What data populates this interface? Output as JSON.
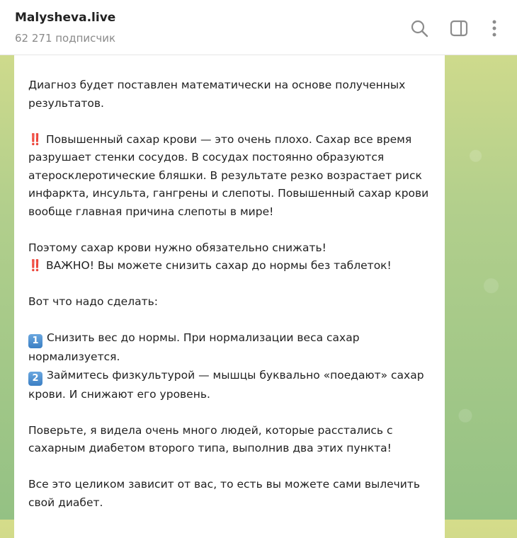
{
  "header": {
    "title": "Malysheva.live",
    "subscribers": "62 271 подписчик",
    "icons": [
      "search-icon",
      "side-panel-icon",
      "more-vertical-icon"
    ]
  },
  "message": {
    "p_diagnosis": "Диагноз будет поставлен математически на основе полученных результатов.",
    "alert_emoji": "‼️",
    "p_sugar": "Повышенный сахар крови — это очень плохо. Сахар все время разрушает стенки сосудов. В сосудах постоянно образуются атеросклеротические бляшки. В результате резко возрастает риск инфаркта, инсульта, гангрены и слепоты. Повышенный сахар крови вообще главная причина слепоты в мире!",
    "p_reduce": "Поэтому сахар крови нужно обязательно снижать!",
    "p_important": "ВАЖНО! Вы можете снизить сахар до нормы без таблеток!",
    "p_todo": "Вот что надо сделать:",
    "step1_num": "1",
    "step1": "Снизить вес до нормы. При нормализации веса сахар нормализуется.",
    "step2_num": "2",
    "step2": "Займитесь физкультурой — мышцы буквально «поедают» сахар крови. И снижают его уровень.",
    "p_believe": "Поверьте, я видела очень много людей, которые расстались с сахарным диабетом второго типа, выполнив два этих пункта!",
    "p_last": "Все это целиком зависит от вас, то есть вы можете сами вылечить свой диабет."
  },
  "colors": {
    "accent_alert": "#e02424",
    "keycap": "#3b7fc4",
    "header_bg": "#ffffff",
    "chat_bg": "#b2cf8c"
  }
}
